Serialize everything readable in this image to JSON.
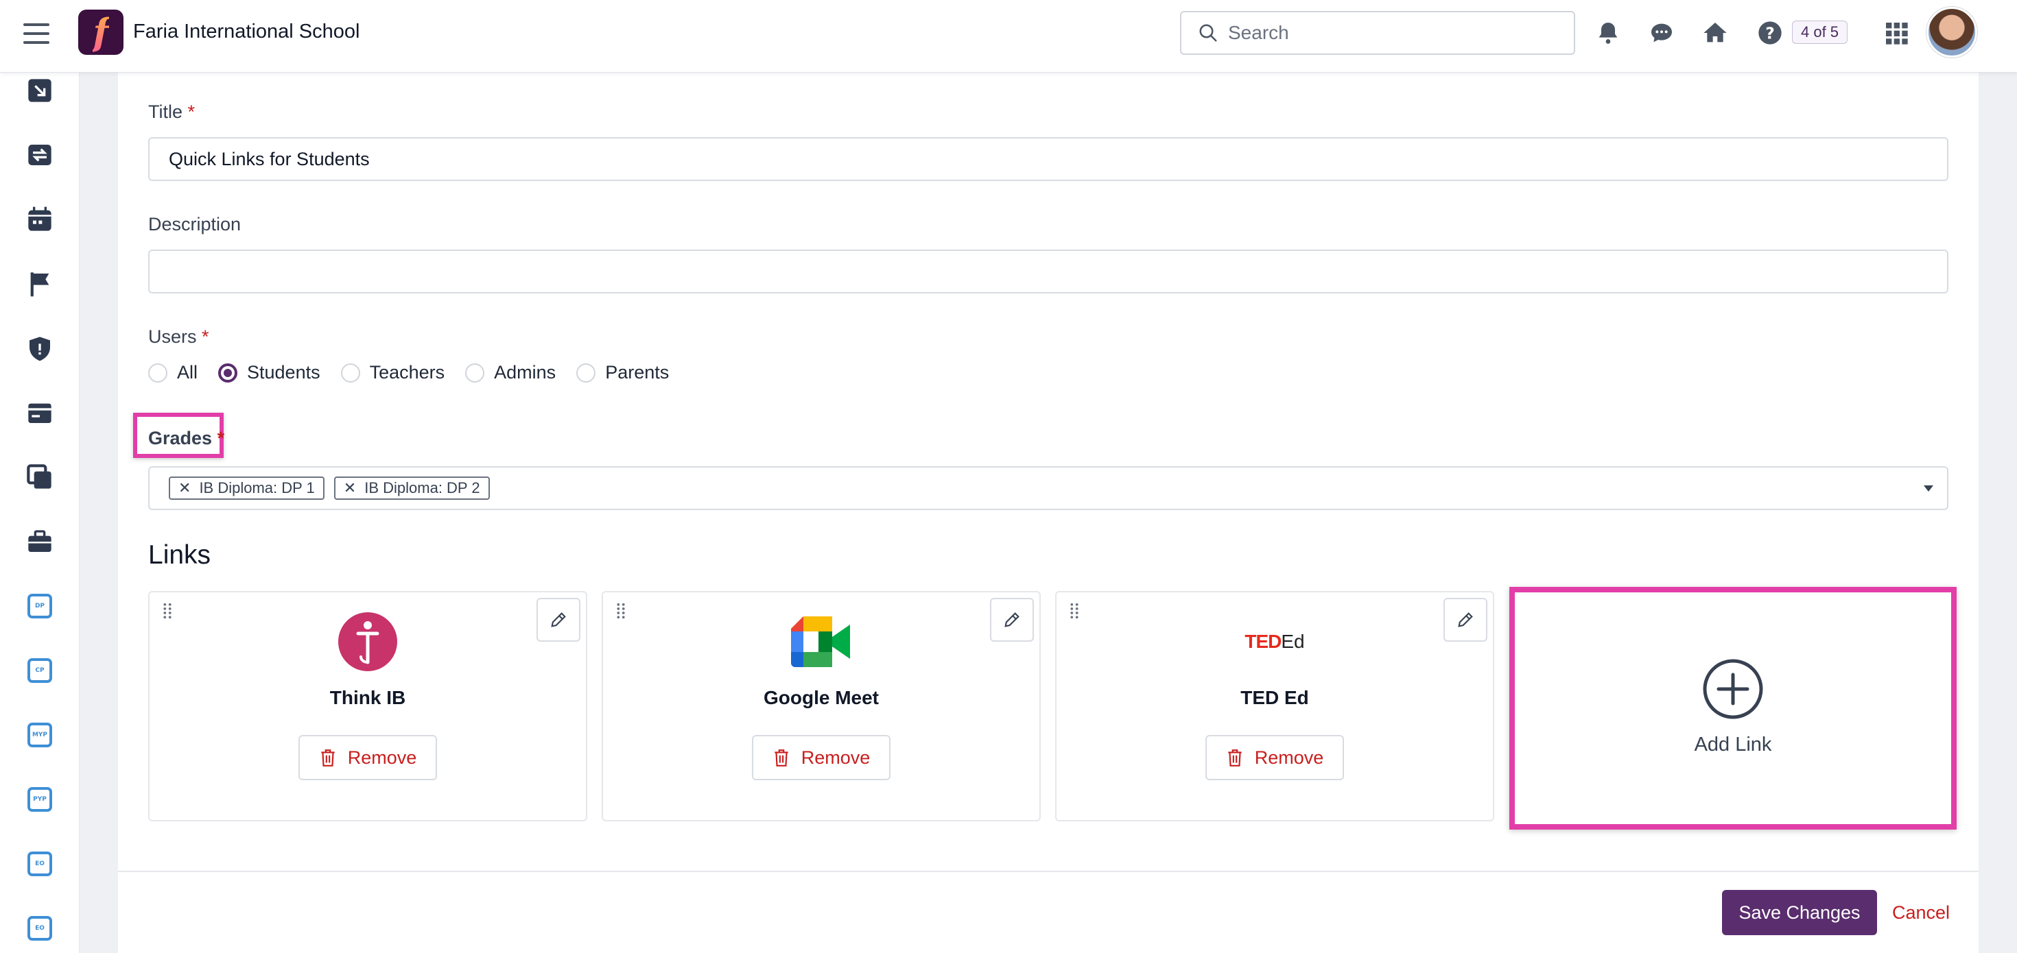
{
  "header": {
    "school_name": "Faria International School",
    "logo_letter": "f",
    "search_placeholder": "Search",
    "page_counter": "4 of 5",
    "icons": [
      "menu-icon",
      "bell-icon",
      "chat-icon",
      "home-icon",
      "help-icon",
      "apps-grid-icon"
    ]
  },
  "sidebar": {
    "icons": [
      "arrow-down-right-icon",
      "transfer-icon",
      "calendar-icon",
      "flag-icon",
      "shield-icon",
      "card-icon",
      "copy-icon",
      "briefcase-icon"
    ],
    "program_icons": [
      "DP",
      "CP",
      "MYP",
      "PYP",
      "EO",
      "EO"
    ]
  },
  "form": {
    "title_label": "Title",
    "title_value": "Quick Links for Students",
    "description_label": "Description",
    "description_value": "",
    "users_label": "Users",
    "users_options": [
      "All",
      "Students",
      "Teachers",
      "Admins",
      "Parents"
    ],
    "users_selected": "Students",
    "grades_label": "Grades",
    "grades_selected": [
      "IB Diploma:  DP 1",
      "IB Diploma:  DP 2"
    ],
    "required_mark": "*"
  },
  "links": {
    "heading": "Links",
    "remove_label": "Remove",
    "items": [
      {
        "title": "Think IB",
        "logo": "think-ib-logo",
        "logo_color": "#c8336a"
      },
      {
        "title": "Google Meet",
        "logo": "google-meet-logo"
      },
      {
        "title": "TED Ed",
        "logo": "ted-ed-logo",
        "logo_color": "#e62b1e"
      }
    ],
    "add_label": "Add Link"
  },
  "footer": {
    "save_label": "Save Changes",
    "cancel_label": "Cancel"
  },
  "colors": {
    "brand": "#5a2d6e",
    "highlight": "#e23ea8",
    "danger": "#c81e1e",
    "program_icon": "#3f8fd6"
  }
}
